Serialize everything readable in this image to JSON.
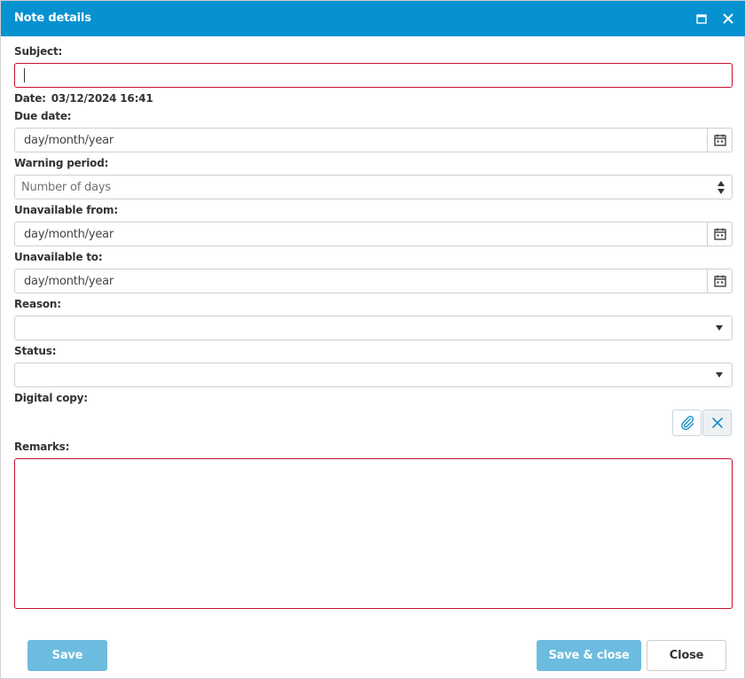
{
  "window": {
    "title": "Note details"
  },
  "form": {
    "subject": {
      "label": "Subject:",
      "value": ""
    },
    "date": {
      "label": "Date:",
      "value": "03/12/2024 16:41"
    },
    "due_date": {
      "label": "Due date:",
      "placeholder": "day/month/year"
    },
    "warning_period": {
      "label": "Warning period:",
      "placeholder": "Number of days"
    },
    "unavailable_from": {
      "label": "Unavailable from:",
      "placeholder": "day/month/year"
    },
    "unavailable_to": {
      "label": "Unavailable to:",
      "placeholder": "day/month/year"
    },
    "reason": {
      "label": "Reason:",
      "value": ""
    },
    "status": {
      "label": "Status:",
      "value": ""
    },
    "digital_copy": {
      "label": "Digital copy:"
    },
    "remarks": {
      "label": "Remarks:",
      "value": ""
    }
  },
  "footer": {
    "save_label": "Save",
    "save_close_label": "Save & close",
    "close_label": "Close"
  },
  "icons": {
    "maximize": "maximize-icon",
    "close": "close-icon",
    "calendar": "calendar-icon",
    "attach": "paperclip-icon",
    "remove": "x-icon"
  },
  "colors": {
    "title_bar": "#0691d0",
    "invalid_border": "#c8102e",
    "primary_button": "#6bbcde"
  }
}
